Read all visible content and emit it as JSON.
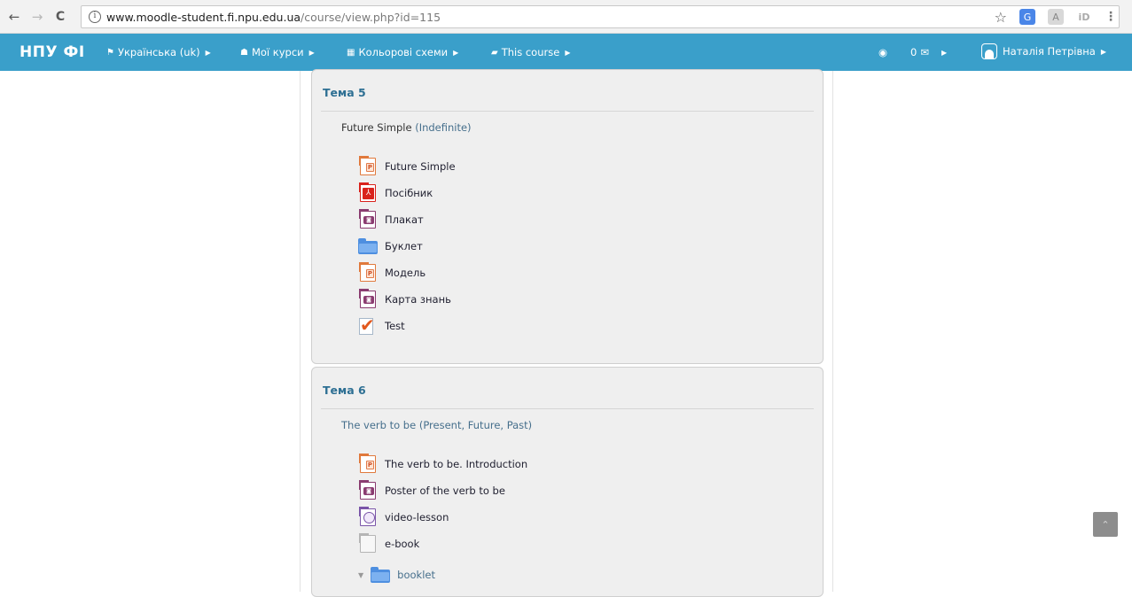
{
  "browser": {
    "back": "←",
    "forward": "→",
    "reload": "C",
    "info": "i",
    "url_host": "www.moodle-student.fi.npu.edu.ua",
    "url_path": "/course/view.php?id=115",
    "star": "☆",
    "ext_menu": "⋮"
  },
  "navbar": {
    "brand": "НПУ ФІ",
    "language": "Українська (uk)",
    "my_courses": "Мої курси",
    "color_schemes": "Кольорові схеми",
    "this_course": "This course",
    "messages_count": "0",
    "user_name": "Наталія Петрівна"
  },
  "sections": [
    {
      "title": "Тема 5",
      "summary_main": "Future Simple",
      "summary_muted": "(Indefinite)",
      "activities": [
        {
          "label": "Future Simple",
          "icon": "ppt-icon"
        },
        {
          "label": "Посібник",
          "icon": "pdf-icon"
        },
        {
          "label": "Плакат",
          "icon": "image-icon"
        },
        {
          "label": "Буклет",
          "icon": "folder-icon"
        },
        {
          "label": "Модель",
          "icon": "ppt-icon"
        },
        {
          "label": "Карта знань",
          "icon": "image-icon"
        },
        {
          "label": "Test",
          "icon": "quiz-icon"
        }
      ]
    },
    {
      "title": "Тема 6",
      "summary": "The verb to be (Present, Future, Past)",
      "activities": [
        {
          "label": "The verb to be. Introduction",
          "icon": "ppt-icon"
        },
        {
          "label": "Poster of the verb to be",
          "icon": "image-icon"
        },
        {
          "label": "video-lesson",
          "icon": "video-icon"
        },
        {
          "label": "e-book",
          "icon": "file-icon"
        },
        {
          "label": "booklet",
          "icon": "folder-icon"
        }
      ]
    }
  ],
  "scroll_top": "⌃"
}
